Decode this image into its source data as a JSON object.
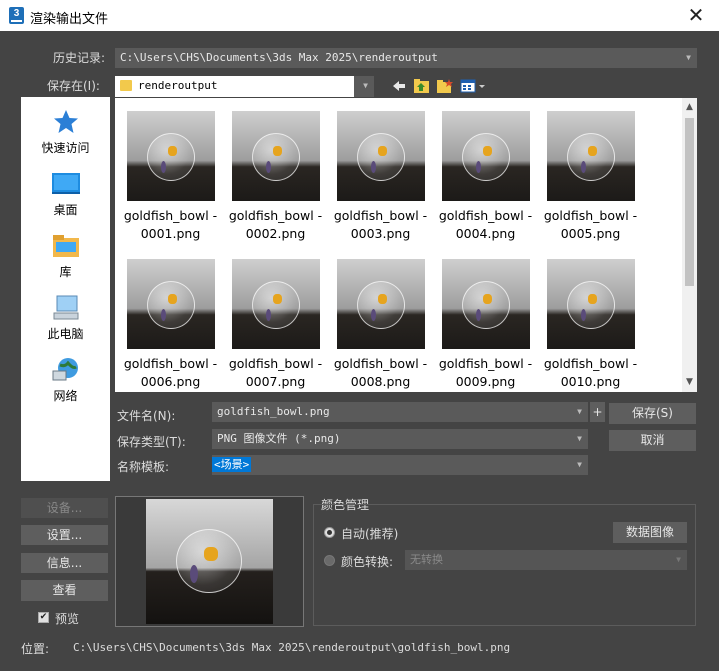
{
  "window": {
    "title": "渲染输出文件",
    "app_icon_text": "3",
    "close_label": "✕"
  },
  "history": {
    "label": "历史记录:",
    "value": "C:\\Users\\CHS\\Documents\\3ds Max 2025\\renderoutput"
  },
  "save_in": {
    "label": "保存在(I):",
    "value": "renderoutput"
  },
  "sidebar": [
    {
      "label": "快速访问",
      "icon": "star-icon"
    },
    {
      "label": "桌面",
      "icon": "desktop-icon"
    },
    {
      "label": "库",
      "icon": "library-icon"
    },
    {
      "label": "此电脑",
      "icon": "computer-icon"
    },
    {
      "label": "网络",
      "icon": "network-icon"
    }
  ],
  "files": [
    {
      "name": "goldfish_bowl -",
      "num": "0001.png"
    },
    {
      "name": "goldfish_bowl -",
      "num": "0002.png"
    },
    {
      "name": "goldfish_bowl -",
      "num": "0003.png"
    },
    {
      "name": "goldfish_bowl -",
      "num": "0004.png"
    },
    {
      "name": "goldfish_bowl -",
      "num": "0005.png"
    },
    {
      "name": "goldfish_bowl -",
      "num": "0006.png"
    },
    {
      "name": "goldfish_bowl -",
      "num": "0007.png"
    },
    {
      "name": "goldfish_bowl -",
      "num": "0008.png"
    },
    {
      "name": "goldfish_bowl -",
      "num": "0009.png"
    },
    {
      "name": "goldfish_bowl -",
      "num": "0010.png"
    }
  ],
  "filename": {
    "label": "文件名(N):",
    "value": "goldfish_bowl.png",
    "plus": "+"
  },
  "save_type": {
    "label": "保存类型(T):",
    "value": "PNG 图像文件 (*.png)"
  },
  "name_template": {
    "label": "名称模板:",
    "value": "<场景>"
  },
  "buttons": {
    "save": "保存(S)",
    "cancel": "取消"
  },
  "left_buttons": {
    "device": "设备...",
    "setup": "设置...",
    "info": "信息...",
    "view": "查看"
  },
  "preview": {
    "label": "预览",
    "checked": true,
    "check_mark": "✔"
  },
  "color_mgmt": {
    "title": "颜色管理",
    "auto_label": "自动(推荐)",
    "data_image_button": "数据图像",
    "convert_label": "颜色转换:",
    "convert_value": "无转换"
  },
  "location": {
    "label": "位置:",
    "value": "C:\\Users\\CHS\\Documents\\3ds Max 2025\\renderoutput\\goldfish_bowl.png"
  },
  "colors": {
    "panel_bg": "#444444",
    "field_bg": "#5a5a5a",
    "accent": "#0078d7",
    "folder": "#f2c94c"
  }
}
